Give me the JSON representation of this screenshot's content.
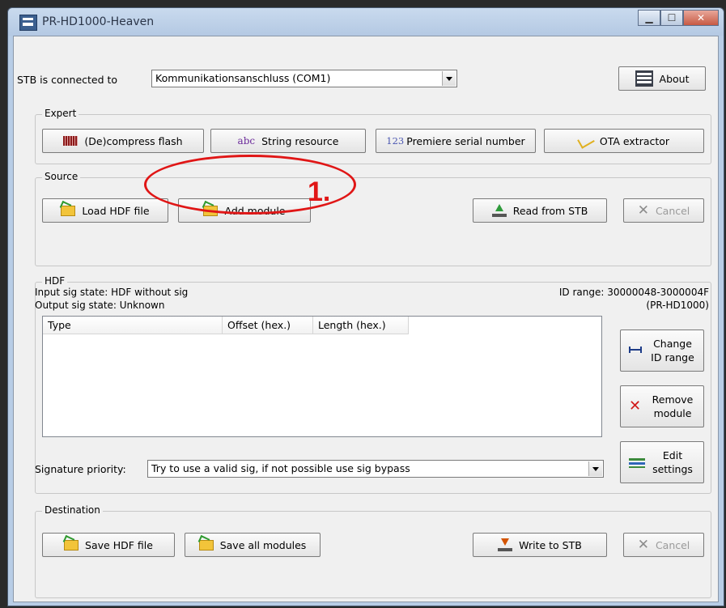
{
  "window": {
    "title": "PR-HD1000-Heaven"
  },
  "connection": {
    "label": "STB is connected to",
    "port_value": "Kommunikationsanschluss (COM1)",
    "about_label": "About"
  },
  "expert": {
    "group_label": "Expert",
    "decompress_label": "(De)compress flash",
    "string_icon": "abc",
    "string_label": "String resource",
    "serial_icon": "123",
    "serial_label": "Premiere serial number",
    "ota_label": "OTA extractor"
  },
  "source": {
    "group_label": "Source",
    "load_label": "Load HDF file",
    "add_label": "Add module",
    "read_label": "Read from STB",
    "cancel_label": "Cancel"
  },
  "annotation": {
    "step_label": "1."
  },
  "hdf": {
    "group_label": "HDF",
    "input_sig": "Input sig state: HDF without sig",
    "output_sig": "Output sig state: Unknown",
    "id_range": "ID range: 30000048-3000004F",
    "model": "(PR-HD1000)",
    "columns": [
      "Type",
      "Offset (hex.)",
      "Length (hex.)"
    ],
    "rows": [],
    "change_range_label": "Change ID range",
    "remove_label": "Remove module",
    "edit_label": "Edit settings",
    "sig_priority_label": "Signature priority:",
    "sig_priority_value": "Try to use a valid sig, if not possible use sig bypass"
  },
  "destination": {
    "group_label": "Destination",
    "save_label": "Save HDF file",
    "save_all_label": "Save all modules",
    "write_label": "Write to STB",
    "cancel_label": "Cancel"
  },
  "colors": {
    "annotation": "#e01616",
    "window_frame": "#b8cde6",
    "client_bg": "#f0f0f0"
  }
}
